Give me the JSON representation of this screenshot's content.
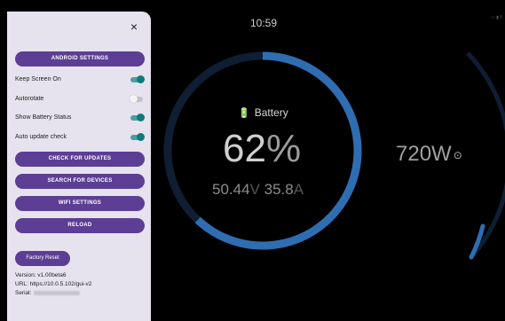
{
  "menu": {
    "close_glyph": "×",
    "android_settings": "ANDROID SETTINGS",
    "toggles": [
      {
        "label": "Keep Screen On",
        "on": true
      },
      {
        "label": "Autorotate",
        "on": false
      },
      {
        "label": "Show Battery Status",
        "on": true
      },
      {
        "label": "Auto update check",
        "on": true
      }
    ],
    "check_updates": "CHECK FOR UPDATES",
    "search_devices": "SEARCH FOR DEVICES",
    "wifi_settings": "WIFI SETTINGS",
    "reload": "RELOAD",
    "factory_reset": "Factory Reset",
    "version": "Version: v1.00beta6",
    "url": "URL: https://10.0.5.102/gui-v2",
    "serial_label": "Serial:"
  },
  "status": {
    "time": "10:59"
  },
  "battery": {
    "icon": "battery-charging-icon",
    "label": "Battery",
    "percent": "62",
    "percent_unit": "%",
    "state_of_charge": 0.62,
    "voltage": "50.44",
    "voltage_unit": "V",
    "current": "35.8",
    "current_unit": "A"
  },
  "power": {
    "value": "720",
    "unit": "W",
    "direction_icon": "charging-direction-icon"
  },
  "colors": {
    "accent": "#2f6db3",
    "track": "#0f1e33",
    "panel": "#e6e3ee",
    "button": "#5c3e94",
    "toggle_on": "#0f7a7a"
  }
}
